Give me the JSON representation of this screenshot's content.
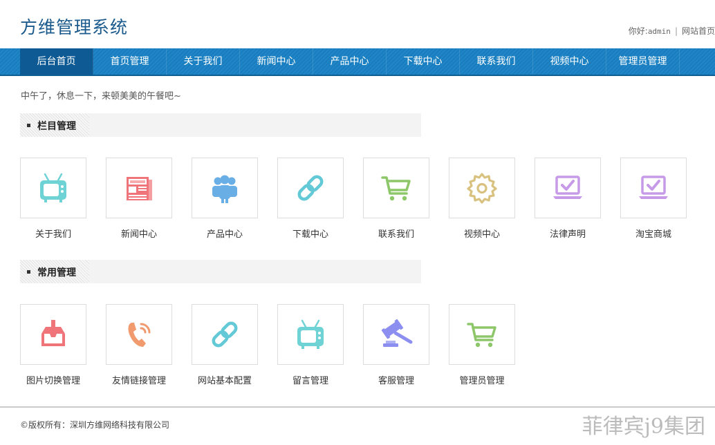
{
  "header": {
    "site_title": "方维管理系统",
    "greeting_prefix": "你好:",
    "username": "admin",
    "separator": "|",
    "home_link": "网站首页"
  },
  "nav": {
    "items": [
      {
        "label": "后台首页",
        "active": true
      },
      {
        "label": "首页管理"
      },
      {
        "label": "关于我们"
      },
      {
        "label": "新闻中心"
      },
      {
        "label": "产品中心"
      },
      {
        "label": "下载中心"
      },
      {
        "label": "联系我们"
      },
      {
        "label": "视频中心"
      },
      {
        "label": "管理员管理"
      }
    ]
  },
  "greeting": "中午了，休息一下，来顿美美的午餐吧~",
  "section1": {
    "title": "栏目管理",
    "tiles": [
      {
        "label": "关于我们",
        "icon": "tv-icon",
        "color": "#6fd3d6"
      },
      {
        "label": "新闻中心",
        "icon": "newspaper-icon",
        "color": "#f0757a"
      },
      {
        "label": "产品中心",
        "icon": "users-icon",
        "color": "#6aaee6"
      },
      {
        "label": "下载中心",
        "icon": "link-icon",
        "color": "#64c9d6"
      },
      {
        "label": "联系我们",
        "icon": "cart-icon",
        "color": "#8dc76a"
      },
      {
        "label": "视频中心",
        "icon": "gear-icon",
        "color": "#d9c27f"
      },
      {
        "label": "法律声明",
        "icon": "laptop-check-icon",
        "color": "#c79ae8"
      },
      {
        "label": "淘宝商城",
        "icon": "laptop-check-icon",
        "color": "#c79ae8"
      }
    ]
  },
  "section2": {
    "title": "常用管理",
    "tiles": [
      {
        "label": "图片切换管理",
        "icon": "inbox-download-icon",
        "color": "#f0757a"
      },
      {
        "label": "友情链接管理",
        "icon": "phone-icon",
        "color": "#f09a6e"
      },
      {
        "label": "网站基本配置",
        "icon": "link-icon",
        "color": "#64c9d6"
      },
      {
        "label": "留言管理",
        "icon": "tv-icon",
        "color": "#6fd3d6"
      },
      {
        "label": "客服管理",
        "icon": "gavel-icon",
        "color": "#8c8ef0"
      },
      {
        "label": "管理员管理",
        "icon": "cart-icon",
        "color": "#8dc76a"
      }
    ]
  },
  "footer": {
    "copyright": "©版权所有：深圳方维网络科技有限公司",
    "watermark": "菲律宾j9集团"
  }
}
